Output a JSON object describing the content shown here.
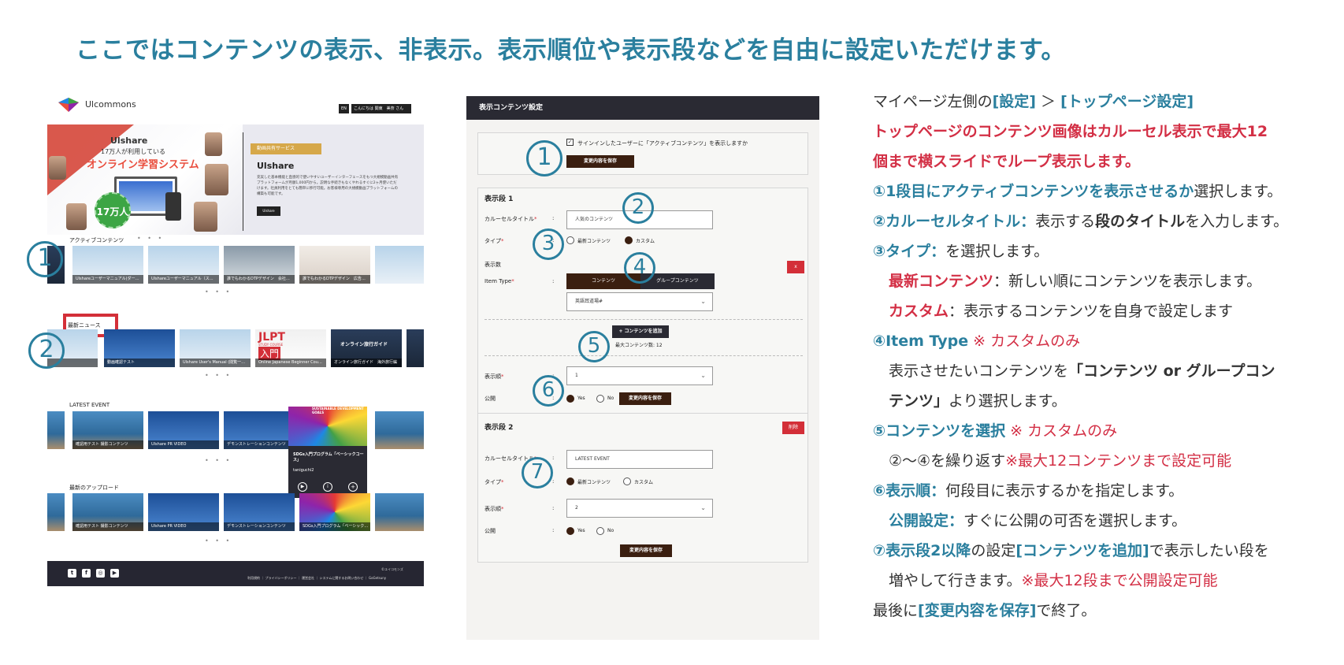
{
  "headline": "ここではコンテンツの表示、非表示。表示順位や表示段などを自由に設定いただけます。",
  "left_screenshot": {
    "logo_text": "Ulcommons",
    "header_lang": "EN",
    "header_user": "こんにちは 関東　美奈 さん",
    "hero": {
      "brand": "Ulshare",
      "line1": "17万人が利用している",
      "line2": "オンライン学習システム",
      "badge": "17万人",
      "ribbon": "動画共有サービス",
      "title": "Ulshare",
      "desc": "充実した基本機能と直感的で使いやすいユーザーインターフェースをもつ大規模動画共有プラットフォームが月額1,000円から。説明な手続きもなくやれるすぐに2ヶ月使いただけます。社員利用をとても簡単に移行可能。お客様専用の大規模動画プラットフォームの構築も可能です。",
      "button": "Ulshare"
    },
    "sections": [
      {
        "title": "アクティブコンテンツ",
        "cards": [
          "Ulshareユーザーマニュアル(ダー…",
          "Ulshareユーザーマニュアル（ス…",
          "誰でもわかるDTPデザイン　会社…",
          "誰でもわかるDTPデザイン　広告…"
        ]
      },
      {
        "title": "最新ニュース",
        "cards": [
          "",
          "動画確認テスト",
          "Ulshare User's Manual (閲覧一…",
          "Online Japanese Beginner Cou…",
          "オンライン旅行ガイド　海外旅行編"
        ]
      },
      {
        "title": "LATEST EVENT",
        "cards": [
          "",
          "確認用テスト 撮影コンテンツ",
          "Ulshare PR VIDEO",
          "デモンストレーションコンテンツ",
          ""
        ]
      },
      {
        "title": "最新のアップロード",
        "cards": [
          "",
          "確認用テスト 撮影コンテンツ",
          "Ulshare PR VIDEO",
          "デモンストレーションコンテンツ",
          "SDGs入門プログラム「ベーシック…"
        ]
      }
    ],
    "card_texts": {
      "jlpt": "JLPT",
      "jlpt_sub": "STUDY COURSE",
      "jlpt_big": "入門",
      "travel": "オンライン旅行ガイド",
      "sdgs": "SUSTAINABLE DEVELOPMENT GOALS"
    },
    "popup": {
      "title": "SDGs入門プログラム「ベーシックコース」",
      "user": "taniguchi2"
    },
    "footer": {
      "copyright": "©ユイコモンズ",
      "links": "利用規約 ｜ プライバシーポリシー ｜ 運営会社 ｜ システムに関するお問い合わせ ｜ GoGetsuny"
    },
    "dots": "• • •",
    "markers": [
      "1",
      "2"
    ]
  },
  "form": {
    "header": "表示コンテンツ設定",
    "active_checkbox_label": "サインインしたユーザーに「アクティブコンテンツ」を表示しますか",
    "save_label": "変更内容を保存",
    "section1": {
      "title": "表示段 1",
      "carousel_label": "カルーセルタイトル",
      "carousel_value": "人気のコンテンツ",
      "type_label": "タイプ",
      "type_opt1": "最新コンテンツ",
      "type_opt2": "カスタム",
      "display_count_label": "表示数",
      "item_type_label": "Item Type",
      "seg_content": "コンテンツ",
      "seg_group": "グループコンテンツ",
      "select_value": "英語耳道場#",
      "add_button": "+ コンテンツを追加",
      "max_note": "最大コンテンツ数: 12",
      "order_label": "表示順",
      "order_value": "1",
      "public_label": "公開",
      "yes": "Yes",
      "no": "No",
      "close": "x"
    },
    "section2": {
      "title": "表示段 2",
      "delete": "削除",
      "carousel_label": "カルーセルタイトル",
      "carousel_value": "LATEST EVENT",
      "type_label": "タイプ",
      "type_opt1": "最新コンテンツ",
      "type_opt2": "カスタム",
      "order_label": "表示順",
      "order_value": "2",
      "public_label": "公開",
      "yes": "Yes",
      "no": "No"
    },
    "colon": ":",
    "required": "*",
    "markers": [
      "1",
      "2",
      "3",
      "4",
      "5",
      "6",
      "7"
    ]
  },
  "instructions": {
    "l1_a": "マイページ左側の",
    "l1_b": "[設定]",
    "l1_c": " ＞ ",
    "l1_d": "[トップページ設定]",
    "l2": "トップページのコンテンツ画像はカルーセル表示で最大12",
    "l3": "個まで横スライドでループ表示します。",
    "l4_a": "①1段目にアクティブコンテンツを表示させるか",
    "l4_b": "選択します。",
    "l5_a": "②カルーセルタイトル：",
    "l5_b": "表示する",
    "l5_c": "段のタイトル",
    "l5_d": "を入力します。",
    "l6_a": "③タイプ：",
    "l6_b": "を選択します。",
    "l7_a": "最新コンテンツ",
    "l7_b": "：新しい順にコンテンツを表示します。",
    "l8_a": "カスタム",
    "l8_b": "：表示するコンテンツを自身で設定します",
    "l9_a": "④Item Type",
    "l9_b": " ※ カスタムのみ",
    "l10_a": "表示させたいコンテンツを",
    "l10_b": "「コンテンツ or グループコン",
    "l11_a": "テンツ」",
    "l11_b": "より選択します。",
    "l12_a": "⑤コンテンツを選択",
    "l12_b": " ※ カスタムのみ",
    "l13_a": "②～④を繰り返す",
    "l13_b": "※最大12コンテンツまで設定可能",
    "l14_a": "⑥表示順：",
    "l14_b": "何段目に表示するかを指定します。",
    "l15_a": "公開設定：",
    "l15_b": "すぐに公開の可否を選択します。",
    "l16_a": "⑦表示段2以降",
    "l16_b": "の設定",
    "l16_c": "[コンテンツを追加]",
    "l16_d": "で表示したい段を",
    "l17_a": "増やして行きます。",
    "l17_b": "※最大12段まで公開設定可能",
    "l18_a": "最後に",
    "l18_b": "[変更内容を保存]",
    "l18_c": "で終了。"
  },
  "colors": {
    "accent": "#2a7f9e",
    "red": "#d32f45",
    "save": "#3b1f10",
    "header_dark": "#2a2a33"
  }
}
